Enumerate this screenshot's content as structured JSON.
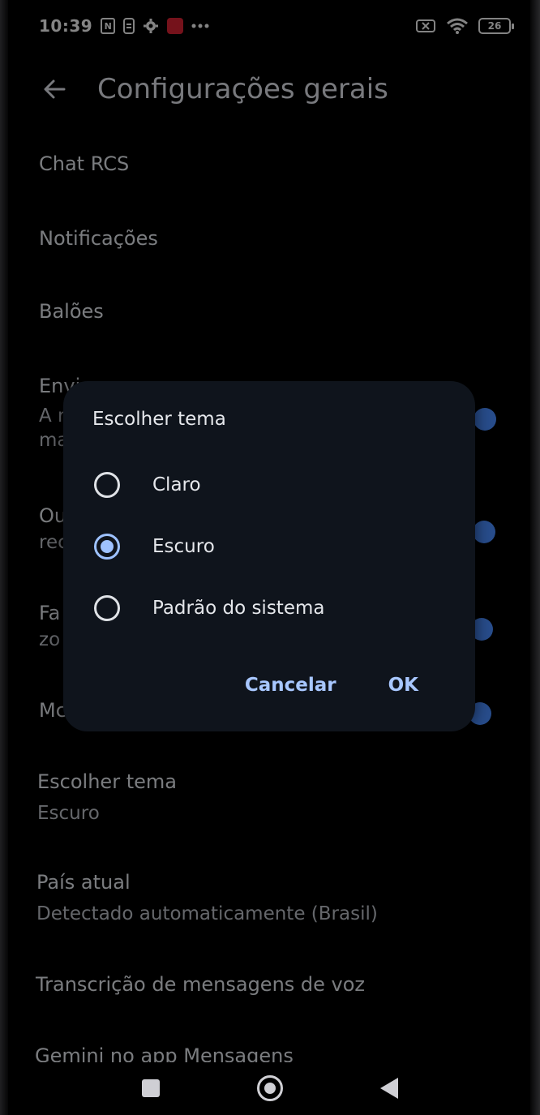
{
  "status_bar": {
    "time": "10:39",
    "battery": "26"
  },
  "header": {
    "title": "Configurações gerais"
  },
  "settings": {
    "chat_rcs": "Chat RCS",
    "notifications": "Notificações",
    "bubbles": "Balões",
    "partial_1_title": "Envi",
    "partial_1_sub_a": "A r",
    "partial_1_sub_b": "ma",
    "partial_2_title": "Ou",
    "partial_2_sub": "rec",
    "partial_3_title": "Fa",
    "partial_3_sub": "zo",
    "partial_4_title": "Mc",
    "theme_title": "Escolher tema",
    "theme_value": "Escuro",
    "country_title": "País atual",
    "country_value": "Detectado automaticamente (Brasil)",
    "voice_transcription": "Transcrição de mensagens de voz",
    "gemini": "Gemini no app Mensagens"
  },
  "dialog": {
    "title": "Escolher tema",
    "options": [
      {
        "label": "Claro",
        "selected": false
      },
      {
        "label": "Escuro",
        "selected": true
      },
      {
        "label": "Padrão do sistema",
        "selected": false
      }
    ],
    "cancel_label": "Cancelar",
    "ok_label": "OK"
  },
  "colors": {
    "background": "#000000",
    "dialog_bg": "#0f141c",
    "accent": "#a8c7ff",
    "toggle": "#4a8cff"
  }
}
